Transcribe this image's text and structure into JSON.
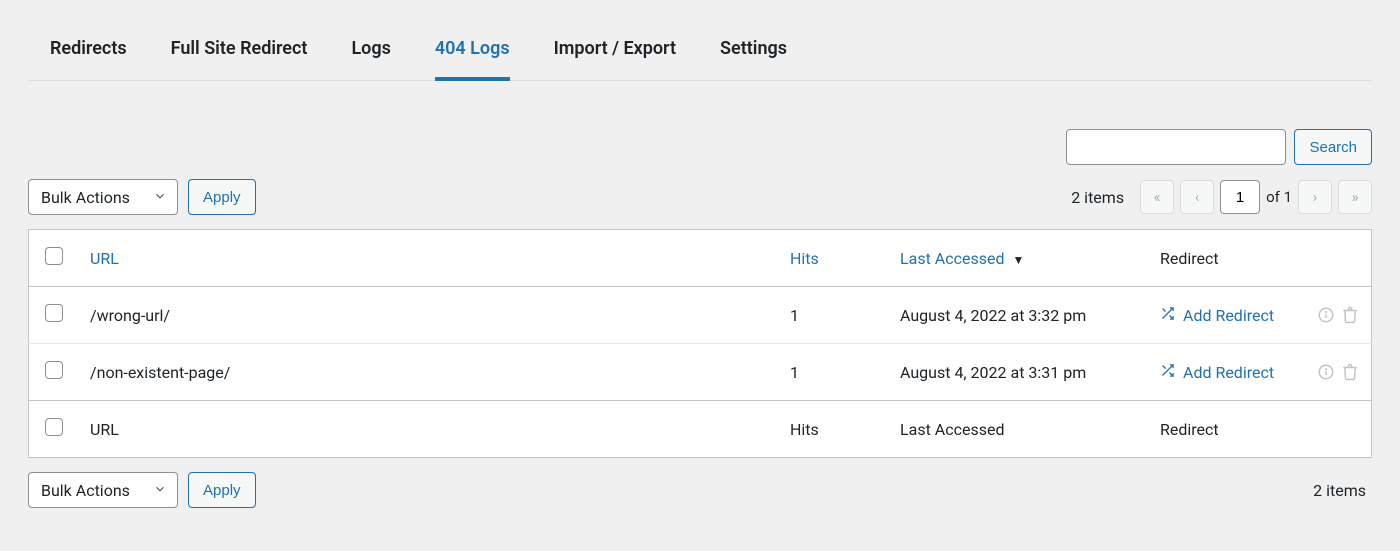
{
  "tabs": [
    {
      "label": "Redirects",
      "active": false
    },
    {
      "label": "Full Site Redirect",
      "active": false
    },
    {
      "label": "Logs",
      "active": false
    },
    {
      "label": "404 Logs",
      "active": true
    },
    {
      "label": "Import / Export",
      "active": false
    },
    {
      "label": "Settings",
      "active": false
    }
  ],
  "search": {
    "value": "",
    "button": "Search"
  },
  "bulk": {
    "label": "Bulk Actions",
    "apply": "Apply"
  },
  "pagination": {
    "items_text": "2 items",
    "page": "1",
    "of_text": "of 1",
    "first": "«",
    "prev": "‹",
    "next": "›",
    "last": "»"
  },
  "columns": {
    "url": "URL",
    "hits": "Hits",
    "last_accessed": "Last Accessed",
    "redirect": "Redirect",
    "sort_indicator": "▼"
  },
  "rows": [
    {
      "url": "/wrong-url/",
      "hits": "1",
      "last": "August 4, 2022 at 3:32 pm",
      "action": "Add Redirect"
    },
    {
      "url": "/non-existent-page/",
      "hits": "1",
      "last": "August 4, 2022 at 3:31 pm",
      "action": "Add Redirect"
    }
  ],
  "footer_columns": {
    "url": "URL",
    "hits": "Hits",
    "last_accessed": "Last Accessed",
    "redirect": "Redirect"
  },
  "bottom_items_text": "2 items"
}
